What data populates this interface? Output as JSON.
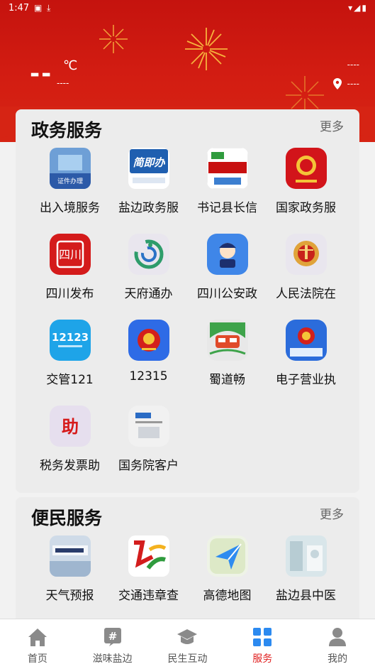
{
  "status_bar": {
    "time": "1:47"
  },
  "weather": {
    "temperature": "--",
    "unit": "℃",
    "description": "----"
  },
  "header": {
    "date": "----",
    "location": "----"
  },
  "gov_services": {
    "title": "政务服务",
    "more": "更多",
    "items": [
      {
        "label": "出入境服务",
        "icon": "exit-entry-service-icon"
      },
      {
        "label": "盐边政务服",
        "icon": "yanbian-gov-icon"
      },
      {
        "label": "书记县长信",
        "icon": "secretary-mailbox-icon"
      },
      {
        "label": "国家政务服",
        "icon": "national-gov-emblem-icon"
      },
      {
        "label": "四川发布",
        "icon": "sichuan-release-icon"
      },
      {
        "label": "天府通办",
        "icon": "tianfu-tongban-icon"
      },
      {
        "label": "四川公安政",
        "icon": "sichuan-police-icon"
      },
      {
        "label": "人民法院在",
        "icon": "peoples-court-icon"
      },
      {
        "label": "交管121",
        "icon": "traffic-12123-icon"
      },
      {
        "label": "12315",
        "icon": "consumer-12315-icon"
      },
      {
        "label": "蜀道畅",
        "icon": "shudaochang-icon"
      },
      {
        "label": "电子营业执",
        "icon": "e-business-license-icon"
      },
      {
        "label": "税务发票助",
        "icon": "tax-invoice-icon"
      },
      {
        "label": "国务院客户",
        "icon": "state-council-icon"
      }
    ]
  },
  "life_services": {
    "title": "便民服务",
    "more": "更多",
    "items": [
      {
        "label": "天气预报",
        "icon": "weather-forecast-icon"
      },
      {
        "label": "交通违章查",
        "icon": "traffic-violation-icon"
      },
      {
        "label": "高德地图",
        "icon": "amap-icon"
      },
      {
        "label": "盐边县中医",
        "icon": "tcm-hospital-icon"
      }
    ]
  },
  "bottom_nav": [
    {
      "label": "首页",
      "icon": "home-icon"
    },
    {
      "label": "滋味盐边",
      "icon": "hashtag-icon"
    },
    {
      "label": "民生互动",
      "icon": "mortarboard-icon"
    },
    {
      "label": "服务",
      "icon": "grid-icon",
      "active": true
    },
    {
      "label": "我的",
      "icon": "user-icon"
    }
  ],
  "colors": {
    "brand_red": "#d31d12",
    "active_nav": "#e02020"
  }
}
